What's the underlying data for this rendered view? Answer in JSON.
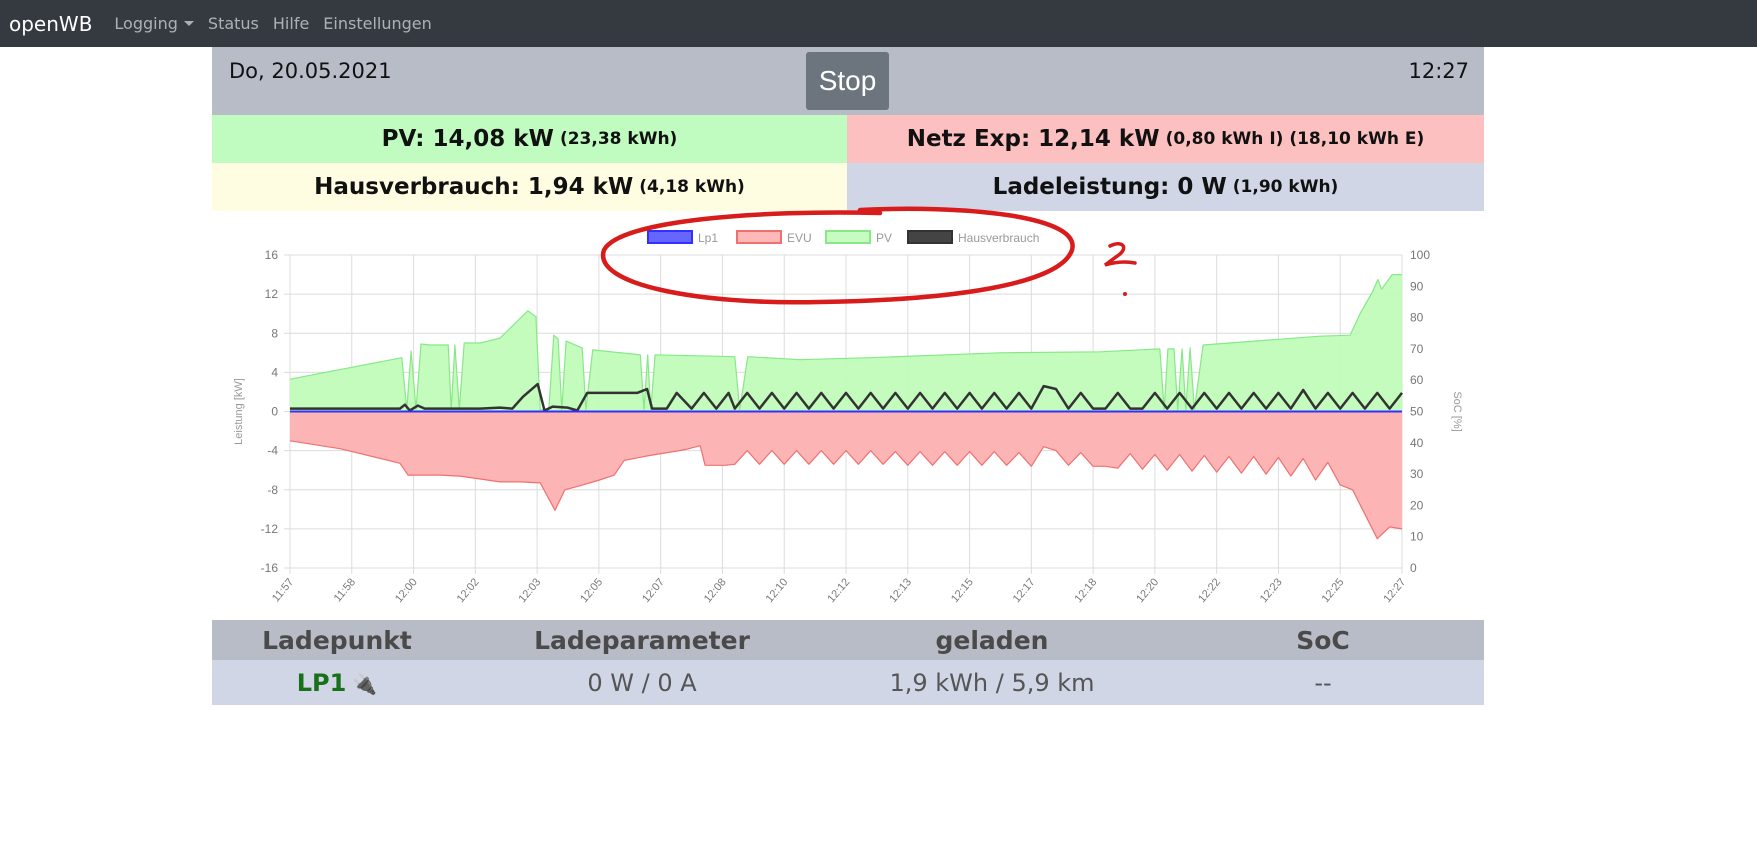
{
  "nav": {
    "brand": "openWB",
    "items": [
      "Logging",
      "Status",
      "Hilfe",
      "Einstellungen"
    ]
  },
  "header": {
    "date": "Do, 20.05.2021",
    "time": "12:27",
    "stop_label": "Stop"
  },
  "summary": {
    "pv_main": "PV: 14,08 kW",
    "pv_sub": "(23,38 kWh)",
    "netz_main": "Netz Exp: 12,14 kW",
    "netz_sub": "(0,80 kWh I) (18,10 kWh E)",
    "haus_main": "Hausverbrauch: 1,94 kW",
    "haus_sub": "(4,18 kWh)",
    "lade_main": "Ladeleistung: 0 W",
    "lade_sub": "(1,90 kWh)"
  },
  "annotation_text": "2",
  "chart_data": {
    "type": "area",
    "ylabel": "Leistung [kW]",
    "y2label": "SoC [%]",
    "ylim": [
      -16,
      16
    ],
    "yticks": [
      16,
      12,
      8,
      4,
      0,
      -4,
      -8,
      -12,
      -16
    ],
    "y2lim": [
      0,
      100
    ],
    "y2ticks": [
      100,
      90,
      80,
      70,
      60,
      50,
      40,
      30,
      20,
      10,
      0
    ],
    "xlim": [
      "11:57:00",
      "12:27:00"
    ],
    "xticks": [
      "11:57",
      "11:58",
      "12:00",
      "12:02",
      "12:03",
      "12:05",
      "12:07",
      "12:08",
      "12:10",
      "12:12",
      "12:13",
      "12:15",
      "12:17",
      "12:18",
      "12:20",
      "12:22",
      "12:23",
      "12:25",
      "12:27"
    ],
    "grid": true,
    "legend": "top",
    "series": [
      {
        "name": "Lp1",
        "color": "#3030ff",
        "fill": "#5555ff",
        "points": [
          [
            "11:57:00",
            0
          ],
          [
            "12:27:00",
            0
          ]
        ]
      },
      {
        "name": "EVU",
        "color": "#f07070",
        "fill": "#fdb0b0",
        "points": [
          [
            "11:57:00",
            -3
          ],
          [
            "11:58:21",
            -3.8
          ],
          [
            "11:59:58",
            -5.3
          ],
          [
            "12:00:11",
            -6.5
          ],
          [
            "12:01:03",
            -6.5
          ],
          [
            "12:01:35",
            -6.6
          ],
          [
            "12:02:08",
            -6.9
          ],
          [
            "12:02:40",
            -7.2
          ],
          [
            "12:03:12",
            -7.2
          ],
          [
            "12:03:45",
            -7.3
          ],
          [
            "12:04:09",
            -10.1
          ],
          [
            "12:04:25",
            -8
          ],
          [
            "12:04:49",
            -7.6
          ],
          [
            "12:05:21",
            -7
          ],
          [
            "12:05:45",
            -6.5
          ],
          [
            "12:06:01",
            -5
          ],
          [
            "12:06:42",
            -4.5
          ],
          [
            "12:07:40",
            -3.9
          ],
          [
            "12:08:04",
            -3.5
          ],
          [
            "12:08:12",
            -5.5
          ],
          [
            "12:08:44",
            -5.5
          ],
          [
            "12:09:00",
            -5.4
          ],
          [
            "12:09:20",
            -4.0
          ],
          [
            "12:09:40",
            -5.4
          ],
          [
            "12:10:00",
            -4.0
          ],
          [
            "12:10:20",
            -5.4
          ],
          [
            "12:10:40",
            -4.0
          ],
          [
            "12:11:00",
            -5.4
          ],
          [
            "12:11:20",
            -4.0
          ],
          [
            "12:11:40",
            -5.4
          ],
          [
            "12:12:00",
            -4.0
          ],
          [
            "12:12:20",
            -5.4
          ],
          [
            "12:12:40",
            -4.0
          ],
          [
            "12:13:00",
            -5.4
          ],
          [
            "12:13:20",
            -4.1
          ],
          [
            "12:13:40",
            -5.5
          ],
          [
            "12:14:00",
            -4.1
          ],
          [
            "12:14:20",
            -5.5
          ],
          [
            "12:14:40",
            -4.1
          ],
          [
            "12:15:00",
            -5.5
          ],
          [
            "12:15:20",
            -4.1
          ],
          [
            "12:15:40",
            -5.5
          ],
          [
            "12:16:00",
            -4.1
          ],
          [
            "12:16:20",
            -5.5
          ],
          [
            "12:16:40",
            -4.2
          ],
          [
            "12:17:00",
            -5.6
          ],
          [
            "12:17:20",
            -3.6
          ],
          [
            "12:17:40",
            -4.0
          ],
          [
            "12:18:00",
            -5.5
          ],
          [
            "12:18:20",
            -4.2
          ],
          [
            "12:18:40",
            -5.6
          ],
          [
            "12:19:00",
            -5.6
          ],
          [
            "12:19:20",
            -5.8
          ],
          [
            "12:19:40",
            -4.3
          ],
          [
            "12:20:00",
            -5.9
          ],
          [
            "12:20:20",
            -4.4
          ],
          [
            "12:20:40",
            -6.0
          ],
          [
            "12:21:00",
            -4.4
          ],
          [
            "12:21:20",
            -6.1
          ],
          [
            "12:21:40",
            -4.5
          ],
          [
            "12:22:00",
            -6.2
          ],
          [
            "12:22:20",
            -4.6
          ],
          [
            "12:22:40",
            -6.3
          ],
          [
            "12:23:00",
            -4.6
          ],
          [
            "12:23:20",
            -6.4
          ],
          [
            "12:23:40",
            -4.7
          ],
          [
            "12:24:00",
            -6.6
          ],
          [
            "12:24:20",
            -4.8
          ],
          [
            "12:24:40",
            -7.0
          ],
          [
            "12:25:00",
            -5.2
          ],
          [
            "12:25:20",
            -7.5
          ],
          [
            "12:25:40",
            -8.0
          ],
          [
            "12:26:00",
            -10.5
          ],
          [
            "12:26:20",
            -13
          ],
          [
            "12:26:40",
            -11.8
          ],
          [
            "12:27:00",
            -12
          ]
        ]
      },
      {
        "name": "PV",
        "color": "#88e888",
        "fill": "#c0fcb8",
        "points": [
          [
            "11:57:00",
            3.3
          ],
          [
            "12:00:01",
            5.5
          ],
          [
            "12:00:09",
            0.2
          ],
          [
            "12:00:16",
            6.2
          ],
          [
            "12:00:24",
            0.2
          ],
          [
            "12:00:32",
            6.9
          ],
          [
            "12:00:47",
            6.8
          ],
          [
            "12:01:16",
            6.8
          ],
          [
            "12:01:21",
            0.2
          ],
          [
            "12:01:27",
            6.8
          ],
          [
            "12:01:34",
            0.2
          ],
          [
            "12:01:42",
            7
          ],
          [
            "12:02:08",
            7
          ],
          [
            "12:02:40",
            7.5
          ],
          [
            "12:03:04",
            9
          ],
          [
            "12:03:25",
            10.3
          ],
          [
            "12:03:38",
            9.7
          ],
          [
            "12:03:45",
            0.2
          ],
          [
            "12:03:59",
            0.2
          ],
          [
            "12:04:07",
            7.8
          ],
          [
            "12:04:14",
            7.4
          ],
          [
            "12:04:20",
            0.2
          ],
          [
            "12:04:27",
            7.2
          ],
          [
            "12:04:53",
            6.5
          ],
          [
            "12:04:59",
            0.2
          ],
          [
            "12:05:10",
            6.3
          ],
          [
            "12:06:27",
            5.8
          ],
          [
            "12:06:33",
            0.2
          ],
          [
            "12:06:39",
            5.8
          ],
          [
            "12:06:44",
            0.2
          ],
          [
            "12:06:51",
            5.8
          ],
          [
            "12:09:00",
            5.6
          ],
          [
            "12:09:08",
            0.2
          ],
          [
            "12:09:21",
            5.6
          ],
          [
            "12:10:46",
            5.3
          ],
          [
            "12:12:39",
            5.5
          ],
          [
            "12:16:09",
            6.0
          ],
          [
            "12:18:51",
            6.1
          ],
          [
            "12:20:28",
            6.4
          ],
          [
            "12:20:35",
            0.2
          ],
          [
            "12:20:41",
            6.4
          ],
          [
            "12:20:51",
            6.4
          ],
          [
            "12:20:57",
            0.2
          ],
          [
            "12:21:04",
            6.4
          ],
          [
            "12:21:10",
            0.2
          ],
          [
            "12:21:17",
            6.5
          ],
          [
            "12:21:24",
            0.2
          ],
          [
            "12:21:38",
            6.8
          ],
          [
            "12:24:47",
            7.7
          ],
          [
            "12:25:36",
            7.8
          ],
          [
            "12:25:52",
            10
          ],
          [
            "12:26:12",
            12.2
          ],
          [
            "12:26:21",
            13.5
          ],
          [
            "12:26:27",
            12.5
          ],
          [
            "12:26:44",
            14
          ],
          [
            "12:27:00",
            14
          ]
        ]
      },
      {
        "name": "Hausverbrauch",
        "color": "#333333",
        "fill": "#444444",
        "line_only": true,
        "points": [
          [
            "11:57:00",
            0.3
          ],
          [
            "11:59:58",
            0.3
          ],
          [
            "12:00:06",
            0.7
          ],
          [
            "12:00:14",
            0.1
          ],
          [
            "12:00:27",
            0.6
          ],
          [
            "12:00:38",
            0.3
          ],
          [
            "12:02:08",
            0.3
          ],
          [
            "12:02:40",
            0.4
          ],
          [
            "12:03:00",
            0.3
          ],
          [
            "12:03:17",
            1.5
          ],
          [
            "12:03:41",
            2.8
          ],
          [
            "12:03:52",
            0.1
          ],
          [
            "12:04:05",
            0.5
          ],
          [
            "12:04:29",
            0.4
          ],
          [
            "12:04:45",
            0.1
          ],
          [
            "12:05:01",
            1.9
          ],
          [
            "12:06:22",
            1.9
          ],
          [
            "12:06:38",
            2.3
          ],
          [
            "12:06:46",
            0.3
          ],
          [
            "12:07:10",
            0.3
          ],
          [
            "12:07:26",
            1.9
          ],
          [
            "12:07:50",
            0.3
          ],
          [
            "12:08:10",
            1.9
          ],
          [
            "12:08:30",
            0.3
          ],
          [
            "12:08:50",
            1.9
          ],
          [
            "12:09:00",
            0.3
          ],
          [
            "12:09:20",
            1.9
          ],
          [
            "12:09:40",
            0.3
          ],
          [
            "12:10:00",
            1.9
          ],
          [
            "12:10:20",
            0.3
          ],
          [
            "12:10:40",
            1.9
          ],
          [
            "12:11:00",
            0.3
          ],
          [
            "12:11:20",
            1.9
          ],
          [
            "12:11:40",
            0.3
          ],
          [
            "12:12:00",
            1.9
          ],
          [
            "12:12:20",
            0.3
          ],
          [
            "12:12:40",
            1.9
          ],
          [
            "12:13:00",
            0.3
          ],
          [
            "12:13:20",
            1.9
          ],
          [
            "12:13:40",
            0.3
          ],
          [
            "12:14:00",
            1.9
          ],
          [
            "12:14:20",
            0.3
          ],
          [
            "12:14:40",
            1.9
          ],
          [
            "12:15:00",
            0.3
          ],
          [
            "12:15:20",
            1.9
          ],
          [
            "12:15:40",
            0.3
          ],
          [
            "12:16:00",
            1.9
          ],
          [
            "12:16:20",
            0.3
          ],
          [
            "12:16:40",
            1.9
          ],
          [
            "12:17:00",
            0.3
          ],
          [
            "12:17:20",
            2.6
          ],
          [
            "12:17:40",
            2.3
          ],
          [
            "12:18:00",
            0.3
          ],
          [
            "12:18:20",
            1.9
          ],
          [
            "12:18:40",
            0.3
          ],
          [
            "12:19:00",
            0.3
          ],
          [
            "12:19:20",
            1.9
          ],
          [
            "12:19:40",
            0.3
          ],
          [
            "12:20:00",
            0.3
          ],
          [
            "12:20:20",
            1.9
          ],
          [
            "12:20:40",
            0.3
          ],
          [
            "12:21:00",
            1.9
          ],
          [
            "12:21:20",
            0.3
          ],
          [
            "12:21:40",
            1.9
          ],
          [
            "12:22:00",
            0.3
          ],
          [
            "12:22:20",
            1.9
          ],
          [
            "12:22:40",
            0.3
          ],
          [
            "12:23:00",
            1.9
          ],
          [
            "12:23:20",
            0.3
          ],
          [
            "12:23:40",
            1.9
          ],
          [
            "12:24:00",
            0.3
          ],
          [
            "12:24:20",
            2.2
          ],
          [
            "12:24:40",
            0.3
          ],
          [
            "12:25:00",
            1.9
          ],
          [
            "12:25:20",
            0.3
          ],
          [
            "12:25:40",
            1.9
          ],
          [
            "12:26:00",
            0.3
          ],
          [
            "12:26:20",
            1.9
          ],
          [
            "12:26:40",
            0.3
          ],
          [
            "12:27:00",
            1.9
          ]
        ]
      }
    ]
  },
  "table": {
    "headers": [
      "Ladepunkt",
      "Ladeparameter",
      "geladen",
      "SoC"
    ],
    "rows": [
      {
        "name": "LP1",
        "icon": "plug-icon",
        "params": "0 W / 0 A",
        "charged": "1,9 kWh / 5,9 km",
        "soc": "--"
      }
    ]
  }
}
